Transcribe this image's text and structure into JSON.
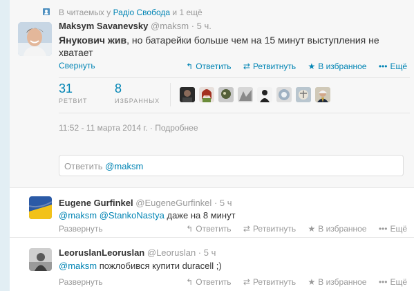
{
  "context": {
    "prefix": "В читаемых у",
    "link": "Радіо Свобода",
    "suffix": "и 1 ещё"
  },
  "tweet": {
    "name": "Maksym Savanevsky",
    "handle": "@maksm",
    "time": "· 5 ч.",
    "text_bold": "Янукович жив",
    "text_rest": ", но батарейки больше чем на 15 минут выступления не хватает",
    "collapse_label": "Свернуть",
    "actions": {
      "reply": "Ответить",
      "retweet": "Ретвитнуть",
      "favorite": "В избранное",
      "more": "Ещё"
    },
    "stats": {
      "retweets_count": "31",
      "retweets_label": "РЕТВИТ",
      "favorites_count": "8",
      "favorites_label": "ИЗБРАННЫХ"
    },
    "timestamp": "11:52 - 11 марта 2014 г.",
    "details_link": "Подробнее"
  },
  "reply_box": {
    "placeholder": "Ответить",
    "mention": "@maksm"
  },
  "replies": [
    {
      "name": "Eugene Gurfinkel",
      "handle": "@EugeneGurfinkel",
      "time": "· 5 ч",
      "mention1": "@maksm",
      "mention2": "@StankoNastya",
      "text": "даже на 8 минут",
      "expand": "Развернуть"
    },
    {
      "name": "LeoruslanLeoruslan",
      "handle": "@Leoruslan",
      "time": "· 5 ч",
      "mention1": "@maksm",
      "text": "пожлобився купити duracell ;)",
      "expand": "Развернуть"
    }
  ],
  "reply_actions": {
    "reply": "Ответить",
    "retweet": "Ретвитнуть",
    "favorite": "В избранное",
    "more": "Ещё"
  },
  "colors": {
    "link": "#0084b4",
    "muted": "#999999",
    "main_bg": "#f7f7f7"
  }
}
